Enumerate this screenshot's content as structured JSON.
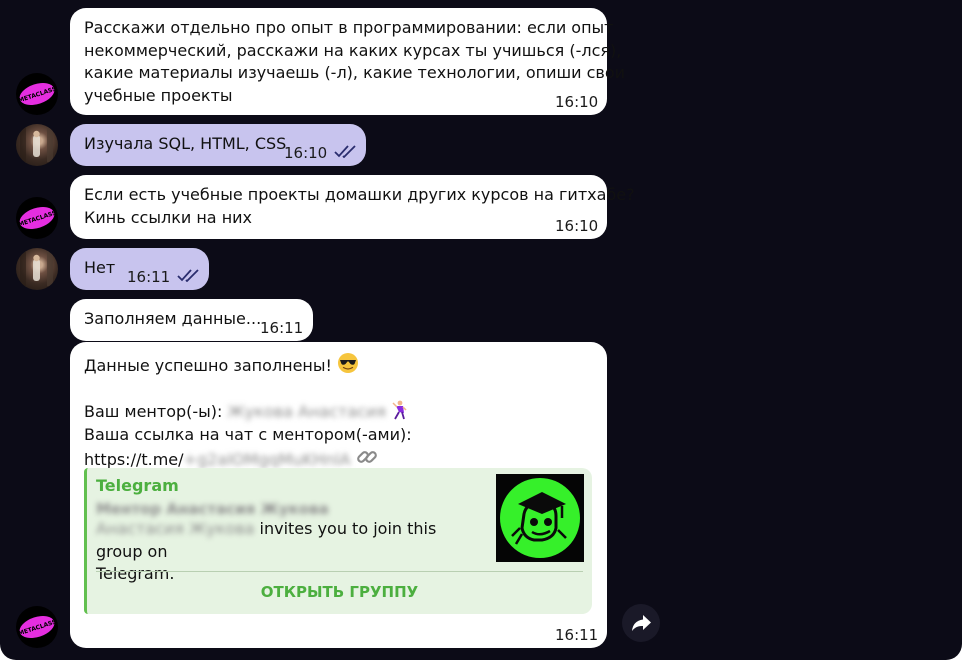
{
  "messages": [
    {
      "text": "Расскажи отдельно про опыт в программировании: если опыт\nнекоммерческий, расскажи на каких курсах ты учишься (-лся),\nкакие материалы изучаешь (-л), какие технологии, опиши свои\nучебные проекты",
      "time": "16:10"
    },
    {
      "text": "Изучала SQL, HTML, CSS",
      "time": "16:10"
    },
    {
      "text": "Если есть учебные проекты домашки других курсов на гитхабе?\nКинь ссылки на них",
      "time": "16:10"
    },
    {
      "text": "Нет",
      "time": "16:11"
    },
    {
      "text": "Заполняем данные...",
      "time": "16:11"
    },
    {
      "line1": "Данные успешно заполнены!",
      "line2_prefix": "Ваш ментор(-ы):",
      "mentor_name": "Жукова Анастасия",
      "line3": "Ваша ссылка на чат с ментором(-ами):",
      "link_prefix": "https://t.me/",
      "link_hidden": "+g2aIOMgqMuKHnlA",
      "time": "16:11",
      "preview": {
        "site": "Telegram",
        "title": "Ментор Анастасия Жукова",
        "desc_hidden": "Анастасия Жукова",
        "desc_visible": "invites you to join this group on\nTelegram.",
        "button": "ОТКРЫТЬ ГРУППУ"
      }
    }
  ],
  "avatars": {
    "bot_text": "METACLASS",
    "bot_logo_color": "#e52ee0"
  },
  "colors": {
    "background": "#0c0b17",
    "incoming_bubble": "#ffffff",
    "outgoing_bubble": "#c8c4ee",
    "link_preview_bg": "#e6f3e2",
    "link_preview_accent": "#62c04f",
    "thumbnail_green": "#36f02a"
  },
  "icons": {
    "read": "double-check-icon",
    "forward": "forward-arrow-icon",
    "sunglasses": "sunglasses-emoji",
    "dancer": "dancer-emoji",
    "link": "link-emoji"
  }
}
